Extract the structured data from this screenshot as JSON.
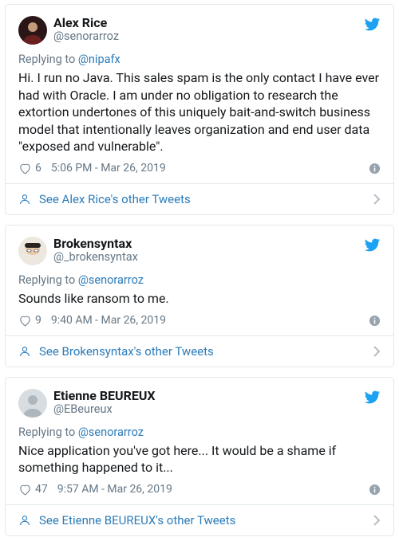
{
  "tweets": [
    {
      "display_name": "Alex Rice",
      "screen_name": "@senorarroz",
      "replying_prefix": "Replying to ",
      "replying_handle": "@nipafx",
      "content": "Hi. I run no Java. This sales spam is the only contact I have ever had with Oracle. I am under no obligation to research the extortion undertones of this uniquely bait-and-switch business model that intentionally leaves organization and end user data \"exposed and vulnerable\".",
      "likes": "6",
      "timestamp": "5:06 PM - Mar 26, 2019",
      "footer_text": "See Alex Rice's other Tweets"
    },
    {
      "display_name": "Brokensyntax",
      "screen_name": "@_brokensyntax",
      "replying_prefix": "Replying to ",
      "replying_handle": "@senorarroz",
      "content": "Sounds like ransom to me.",
      "likes": "9",
      "timestamp": "9:40 AM - Mar 26, 2019",
      "footer_text": "See Brokensyntax's other Tweets"
    },
    {
      "display_name": "Etienne BEUREUX",
      "screen_name": "@EBeureux",
      "replying_prefix": "Replying to ",
      "replying_handle": "@senorarroz",
      "content": "Nice application you've got here... It would be a shame if something happened to it...",
      "likes": "47",
      "timestamp": "9:57 AM - Mar 26, 2019",
      "footer_text": "See Etienne BEUREUX's other Tweets"
    }
  ]
}
